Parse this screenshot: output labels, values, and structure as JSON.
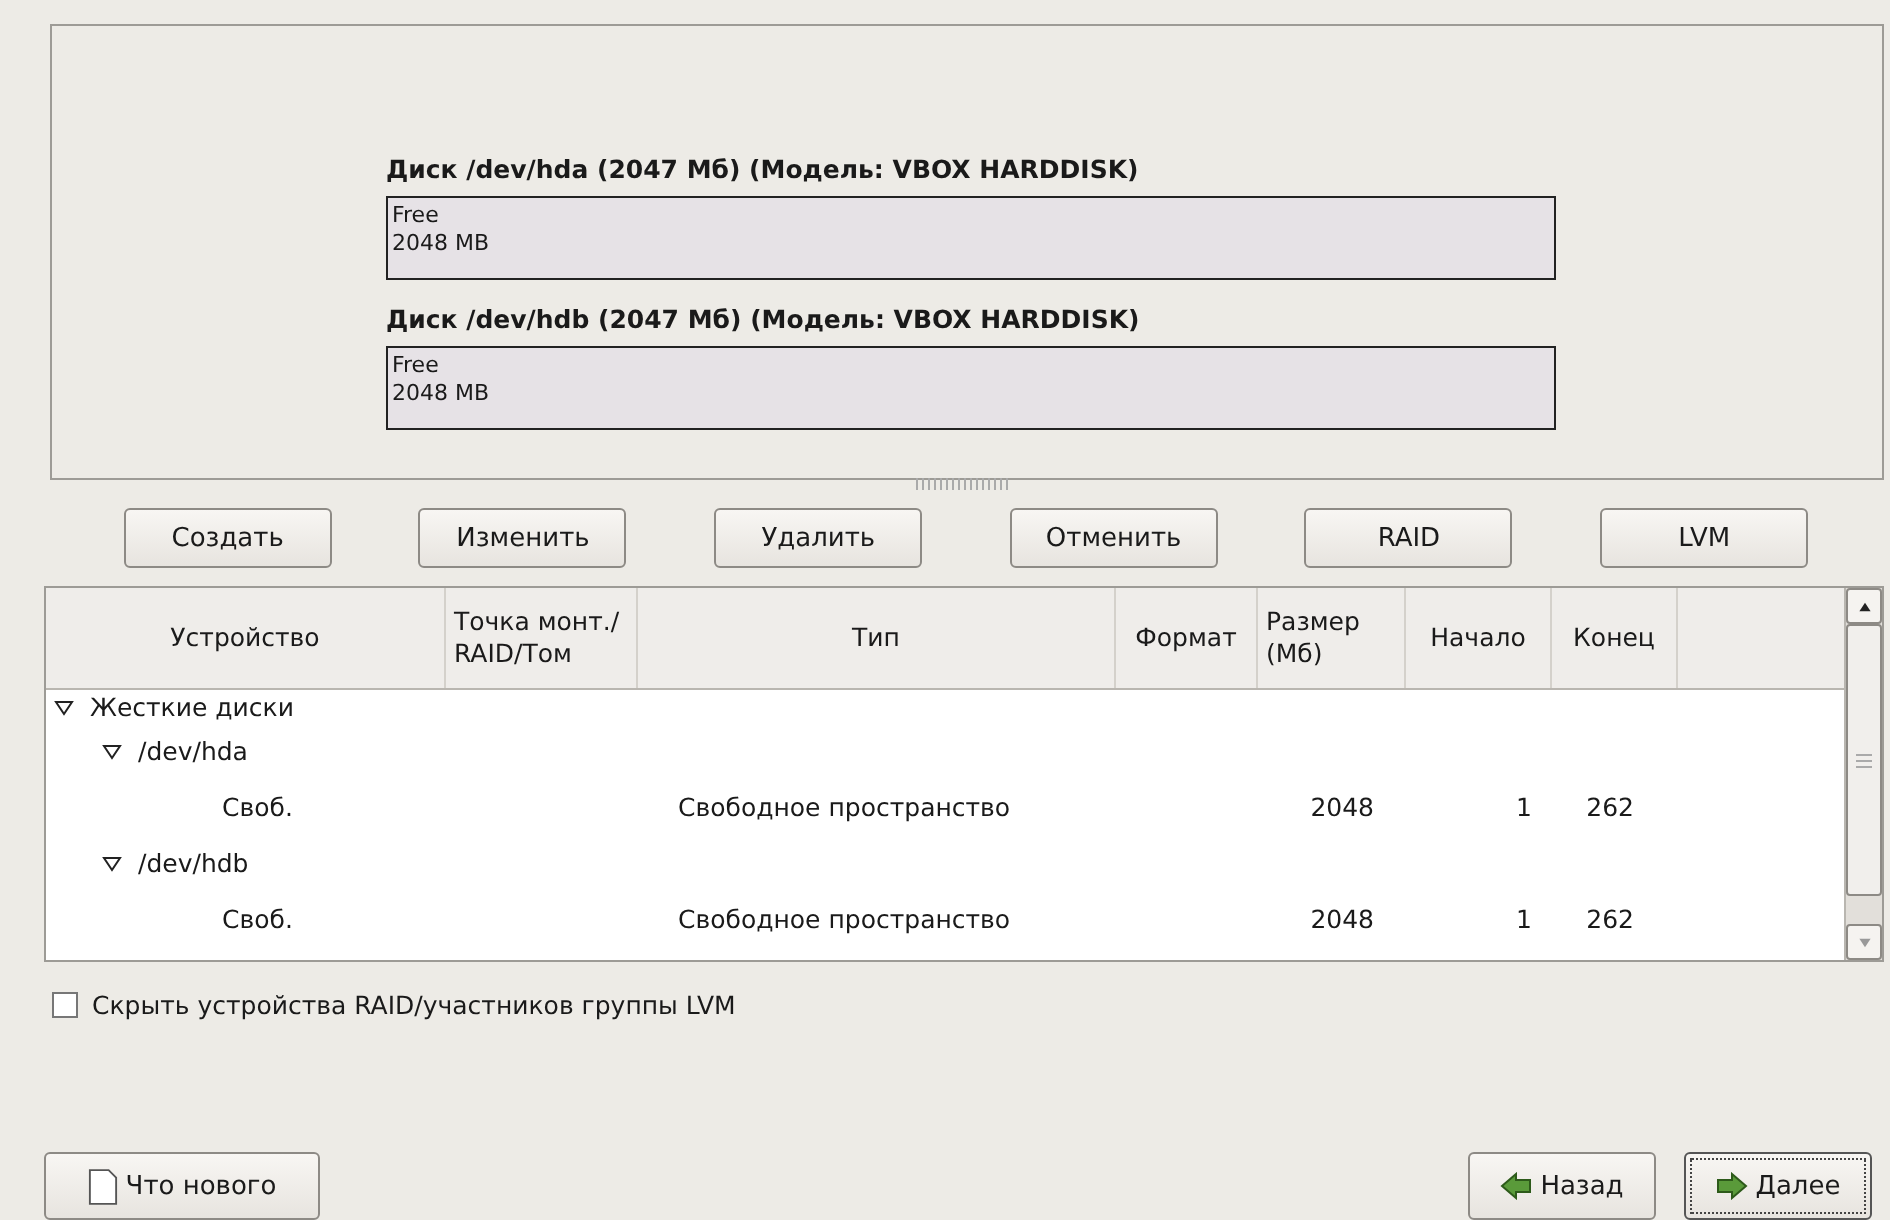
{
  "disks": [
    {
      "title": "Диск /dev/hda (2047 Мб) (Модель: VBOX HARDDISK)",
      "segments": [
        {
          "label": "Free",
          "size": "2048 MB"
        }
      ]
    },
    {
      "title": "Диск /dev/hdb (2047 Мб) (Модель: VBOX HARDDISK)",
      "segments": [
        {
          "label": "Free",
          "size": "2048 MB"
        }
      ]
    }
  ],
  "actions": [
    "Создать",
    "Изменить",
    "Удалить",
    "Отменить",
    "RAID",
    "LVM"
  ],
  "table": {
    "columns": [
      "Устройство",
      "Точка монт./\nRAID/Том",
      "Тип",
      "Формат",
      "Размер\n(Мб)",
      "Начало",
      "Конец"
    ],
    "rows": [
      {
        "device": "Жесткие диски",
        "expanded": true,
        "children": [
          {
            "device": "/dev/hda",
            "expanded": true,
            "children": [
              {
                "device": "Своб.",
                "type": "Свободное пространство",
                "size": "2048",
                "start": "1",
                "end": "262"
              }
            ]
          },
          {
            "device": "/dev/hdb",
            "expanded": true,
            "children": [
              {
                "device": "Своб.",
                "type": "Свободное пространство",
                "size": "2048",
                "start": "1",
                "end": "262"
              }
            ]
          }
        ]
      }
    ]
  },
  "hide_raid": {
    "label": "Скрыть устройства RAID/участников группы LVM",
    "checked": false
  },
  "footer": {
    "release_notes": "Что нового",
    "back": "Назад",
    "next": "Далее"
  }
}
